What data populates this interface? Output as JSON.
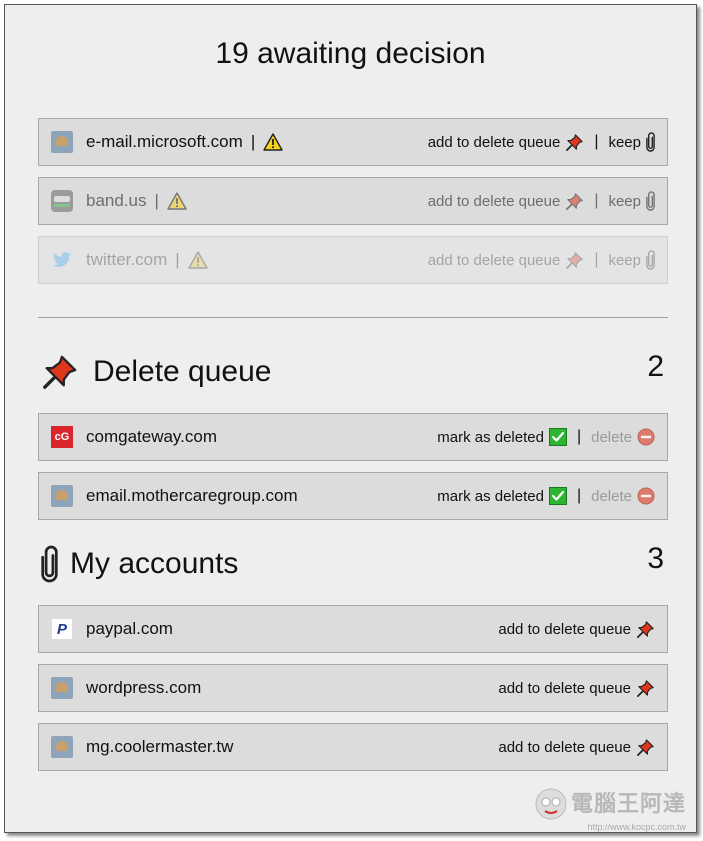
{
  "header": {
    "title": "19 awaiting decision"
  },
  "awaiting": [
    {
      "domain": "e-mail.microsoft.com",
      "sep": "|",
      "action_queue": "add to delete queue",
      "action_sep": "|",
      "action_keep": "keep"
    },
    {
      "domain": "band.us",
      "sep": "|",
      "action_queue": "add to delete queue",
      "action_sep": "|",
      "action_keep": "keep"
    },
    {
      "domain": "twitter.com",
      "sep": "|",
      "action_queue": "add to delete queue",
      "action_sep": "|",
      "action_keep": "keep"
    }
  ],
  "delete_queue": {
    "title": "Delete queue",
    "count": "2",
    "items": [
      {
        "domain": "comgateway.com",
        "mark_label": "mark as deleted",
        "sep": "|",
        "delete_label": "delete",
        "favicon_text": "cG"
      },
      {
        "domain": "email.mothercaregroup.com",
        "mark_label": "mark as deleted",
        "sep": "|",
        "delete_label": "delete"
      }
    ]
  },
  "my_accounts": {
    "title": "My accounts",
    "count": "3",
    "items": [
      {
        "domain": "paypal.com",
        "action_queue": "add to delete queue",
        "favicon_text": "P"
      },
      {
        "domain": "wordpress.com",
        "action_queue": "add to delete queue"
      },
      {
        "domain": "mg.coolermaster.tw",
        "action_queue": "add to delete queue"
      }
    ]
  },
  "watermark": {
    "text": "電腦王阿達",
    "url": "http://www.kocpc.com.tw"
  },
  "icons": {
    "warning": "warning-triangle-icon",
    "pushpin": "pushpin-icon",
    "paperclip": "paperclip-icon",
    "checkmark": "check-mark-icon",
    "no_entry": "no-entry-icon"
  },
  "colors": {
    "background": "#eeeeee",
    "row_bg": "#dcdcdc",
    "pin_red": "#e0361b",
    "check_green": "#2db532",
    "cg_red": "#d9262a"
  }
}
